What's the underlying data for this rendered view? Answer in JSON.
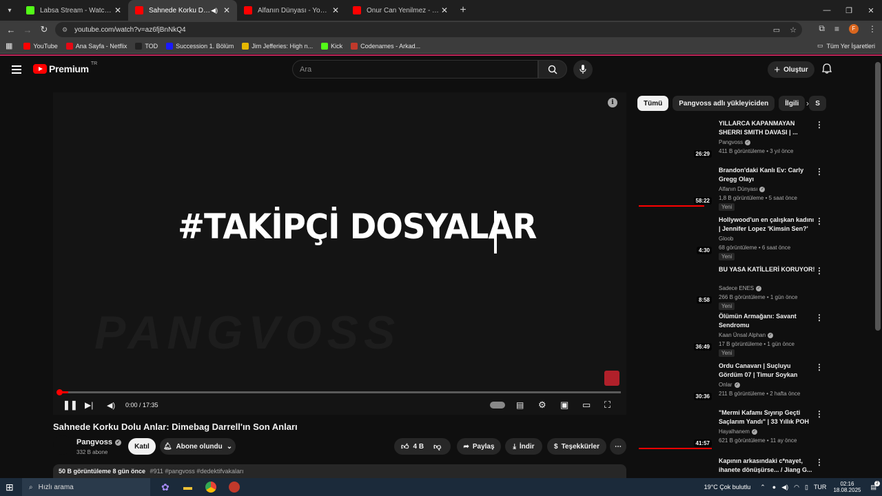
{
  "browser": {
    "tabs": [
      {
        "title": "Labsa Stream - Watch Live on Kick",
        "icon_color": "#53fc18",
        "active": false,
        "sound": false
      },
      {
        "title": "Sahnede Korku Dolu Anlar: Dimebag",
        "icon_color": "#ff0000",
        "active": true,
        "sound": true
      },
      {
        "title": "Alfanın Dünyası - YouTube",
        "icon_color": "#ff0000",
        "active": false,
        "sound": false
      },
      {
        "title": "Onur Can Yenilmez - YouTube",
        "icon_color": "#ff0000",
        "active": false,
        "sound": false
      }
    ],
    "url": "youtube.com/watch?v=az6fjBnNkQ4",
    "profile_initial": "F",
    "bookmarks": [
      {
        "label": "YouTube",
        "color": "#ff0000"
      },
      {
        "label": "Ana Sayfa - Netflix",
        "color": "#e50914"
      },
      {
        "label": "TOD",
        "color": "#222"
      },
      {
        "label": "Succession 1. Bölüm",
        "color": "#1a1aff"
      },
      {
        "label": "Jim Jefferies: High n...",
        "color": "#e6b800"
      },
      {
        "label": "Kick",
        "color": "#53fc18"
      },
      {
        "label": "Codenames - Arkad...",
        "color": "#c0392b"
      }
    ],
    "all_bookmarks": "Tüm Yer İşaretleri"
  },
  "yt": {
    "logo_text": "Premium",
    "logo_region": "TR",
    "search_placeholder": "Ara",
    "create_label": "Oluştur",
    "accent": "#ff0000"
  },
  "player": {
    "overlay_text": "#TAKİPÇİ DOSYALAR",
    "watermark": "PANGVOSS",
    "time": "0:00 / 17:35",
    "progress_fraction": 0.0
  },
  "video": {
    "title": "Sahnede Korku Dolu Anlar: Dimebag Darrell'ın Son Anları",
    "channel": "Pangvoss",
    "subscribers": "332 B abone",
    "join_label": "Katıl",
    "subscribed_label": "Abone olundu",
    "likes": "4 B",
    "share_label": "Paylaş",
    "download_label": "İndir",
    "thanks_label": "Teşekkürler",
    "desc_views": "50 B görüntüleme  8 gün önce",
    "desc_tags": "#911 #pangvoss #dedektifvakaları"
  },
  "chips": [
    "Tümü",
    "Pangvoss adlı yükleyiciden",
    "İlgili",
    "S"
  ],
  "recommendations": [
    {
      "title": "YILLARCA KAPANMAYAN SHERRI SMITH DAVASI | ...",
      "channel": "Pangvoss",
      "verified": true,
      "meta": "411 B görüntüleme • 3 yıl önce",
      "duration": "26:29",
      "badge": "",
      "watched": 0
    },
    {
      "title": "Brandon'daki Kanlı Ev: Carly Gregg Olayı",
      "channel": "Alfanın Dünyası",
      "verified": true,
      "meta": "1,8 B görüntüleme • 5 saat önce",
      "duration": "58:22",
      "badge": "Yeni",
      "watched": 0.9
    },
    {
      "title": "Hollywood'un en çalışkan kadını | Jennifer Lopez 'Kimsin Sen?'",
      "channel": "Gloob",
      "verified": false,
      "meta": "68 görüntüleme • 6 saat önce",
      "duration": "4:30",
      "badge": "Yeni",
      "watched": 0
    },
    {
      "title": "BU YASA KATİLLERİ KORUYOR!",
      "channel": "Sadece ENES",
      "verified": true,
      "meta": "266 B görüntüleme • 1 gün önce",
      "duration": "8:58",
      "badge": "Yeni",
      "watched": 0
    },
    {
      "title": "Ölümün Armağanı: Savant Sendromu",
      "channel": "Kaan Ünsal Alphan",
      "verified": true,
      "meta": "17 B görüntüleme • 1 gün önce",
      "duration": "36:49",
      "badge": "Yeni",
      "watched": 0
    },
    {
      "title": "Ordu Canavarı | Suçluyu Gördüm 07 | Timur Soykan",
      "channel": "Onlar",
      "verified": true,
      "meta": "211 B görüntüleme • 2 hafta önce",
      "duration": "30:36",
      "badge": "",
      "watched": 0
    },
    {
      "title": "\"Mermi Kafamı Sıyırıp Geçti Saçlarım Yandı\" | 33 Yıllık POH",
      "channel": "Hayalhanem",
      "verified": true,
      "meta": "621 B görüntüleme • 11 ay önce",
      "duration": "41:57",
      "badge": "",
      "watched": 1.0
    },
    {
      "title": "Kapının arkasındaki c*nayet, ihanete dönüşürse... / Jiang G...",
      "channel": "",
      "verified": false,
      "meta": "",
      "duration": "",
      "badge": "",
      "watched": 0
    }
  ],
  "taskbar": {
    "search_placeholder": "Hızlı arama",
    "weather": "19°C  Çok bulutlu",
    "lang": "TUR",
    "time": "02:16",
    "date": "18.08.2025",
    "notifications": "2"
  }
}
